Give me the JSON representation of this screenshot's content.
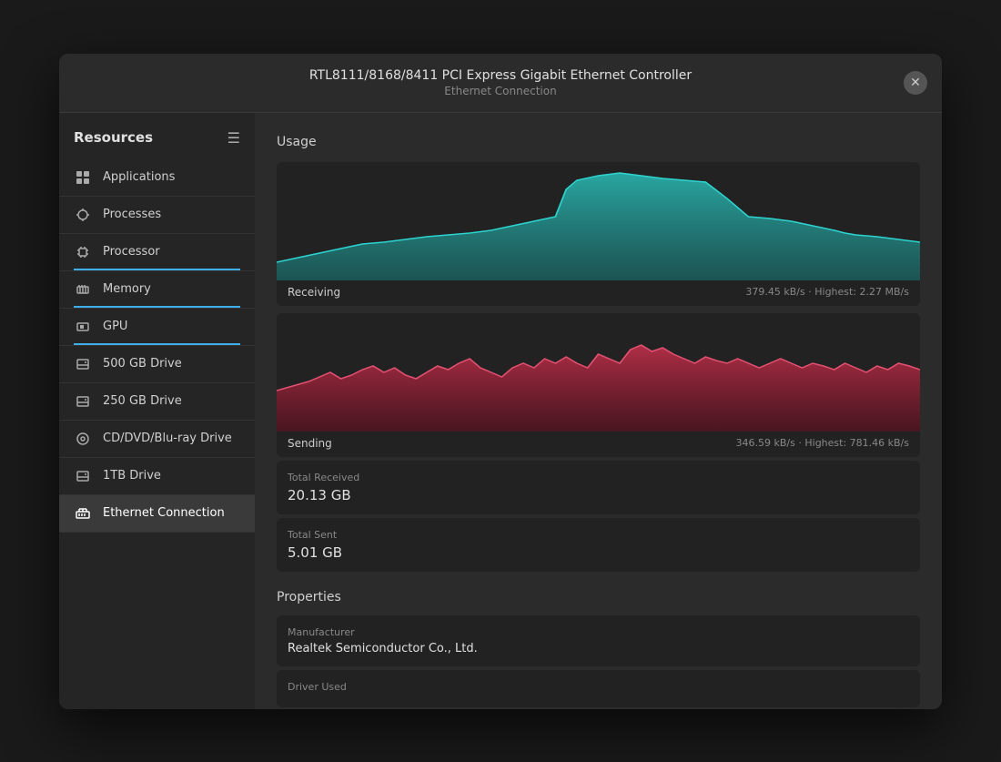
{
  "window": {
    "title_main": "RTL8111/8168/8411 PCI Express Gigabit Ethernet Controller",
    "title_sub": "Ethernet Connection",
    "close_label": "✕"
  },
  "sidebar": {
    "header": "Resources",
    "menu_icon": "☰",
    "items": [
      {
        "id": "applications",
        "label": "Applications",
        "icon": "▣",
        "active": false,
        "underline_color": ""
      },
      {
        "id": "processes",
        "label": "Processes",
        "icon": "◈",
        "active": false,
        "underline_color": ""
      },
      {
        "id": "processor",
        "label": "Processor",
        "icon": "⬡",
        "active": false,
        "underline_color": "#3daee9"
      },
      {
        "id": "memory",
        "label": "Memory",
        "icon": "▦",
        "active": false,
        "underline_color": "#3daee9"
      },
      {
        "id": "gpu",
        "label": "GPU",
        "icon": "▣",
        "active": false,
        "underline_color": "#3daee9"
      },
      {
        "id": "500gb",
        "label": "500 GB Drive",
        "icon": "▤",
        "active": false,
        "underline_color": ""
      },
      {
        "id": "250gb",
        "label": "250 GB Drive",
        "icon": "▤",
        "active": false,
        "underline_color": ""
      },
      {
        "id": "cddvd",
        "label": "CD/DVD/Blu-ray Drive",
        "icon": "◎",
        "active": false,
        "underline_color": ""
      },
      {
        "id": "1tb",
        "label": "1TB Drive",
        "icon": "▤",
        "active": false,
        "underline_color": ""
      },
      {
        "id": "ethernet",
        "label": "Ethernet Connection",
        "icon": "⊞",
        "active": true,
        "underline_color": ""
      }
    ]
  },
  "main": {
    "usage_title": "Usage",
    "receiving_label": "Receiving",
    "receiving_stat": "379.45 kB/s · Highest: 2.27 MB/s",
    "sending_label": "Sending",
    "sending_stat": "346.59 kB/s · Highest: 781.46 kB/s",
    "total_received_label": "Total Received",
    "total_received_value": "20.13 GB",
    "total_sent_label": "Total Sent",
    "total_sent_value": "5.01 GB",
    "properties_title": "Properties",
    "manufacturer_label": "Manufacturer",
    "manufacturer_value": "Realtek Semiconductor Co., Ltd.",
    "driver_label": "Driver Used",
    "driver_value": ""
  },
  "colors": {
    "receive_fill": "#2a7c7a",
    "receive_line": "#2ab5b0",
    "send_fill": "#7a2040",
    "send_line": "#c0304a",
    "sidebar_active_bg": "#3a3a3a",
    "underline_blue": "#3daee9"
  }
}
